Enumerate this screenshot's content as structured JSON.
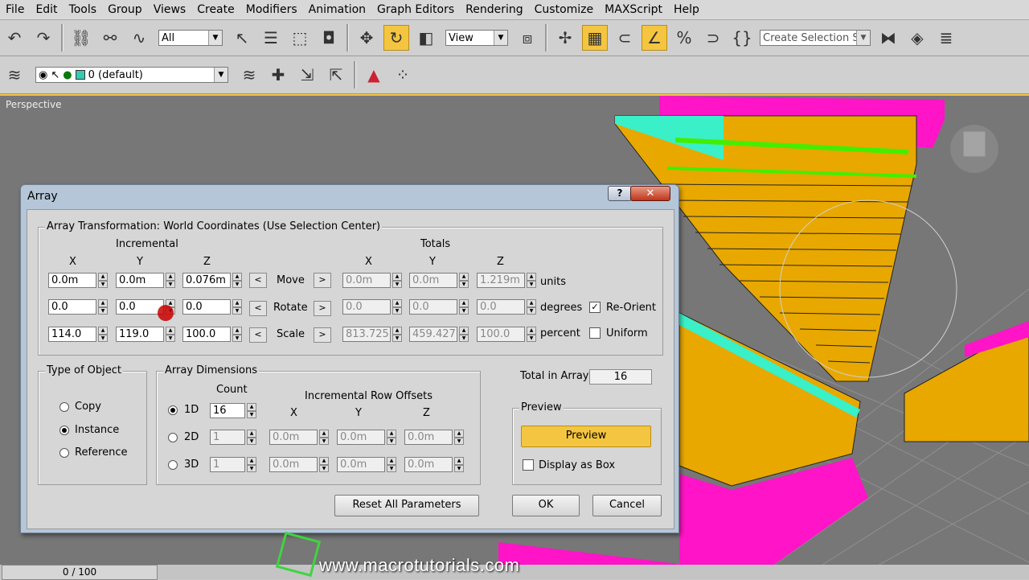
{
  "menu": [
    "File",
    "Edit",
    "Tools",
    "Group",
    "Views",
    "Create",
    "Modifiers",
    "Animation",
    "Graph Editors",
    "Rendering",
    "Customize",
    "MAXScript",
    "Help"
  ],
  "toolbar": {
    "selection_filter": "All",
    "ref_coord": "View",
    "selection_set_placeholder": "Create Selection Set"
  },
  "layer_toolbar": {
    "layer_name": "0 (default)"
  },
  "viewport": {
    "label": "Perspective"
  },
  "timeslider": {
    "value": "0 / 100"
  },
  "watermark": "www.macrotutorials.com",
  "dialog": {
    "title": "Array",
    "help_label": "?",
    "close_label": "✕",
    "transform_group_title": "Array Transformation: World Coordinates (Use Selection Center)",
    "incremental_label": "Incremental",
    "totals_label": "Totals",
    "axis_labels": [
      "X",
      "Y",
      "Z"
    ],
    "rows": [
      {
        "name": "Move",
        "inc": [
          "0.0m",
          "0.0m",
          "0.076m"
        ],
        "tot": [
          "0.0m",
          "0.0m",
          "1.219m"
        ],
        "unit": "units"
      },
      {
        "name": "Rotate",
        "inc": [
          "0.0",
          "0.0",
          "0.0"
        ],
        "tot": [
          "0.0",
          "0.0",
          "0.0"
        ],
        "unit": "degrees"
      },
      {
        "name": "Scale",
        "inc": [
          "114.0",
          "119.0",
          "100.0"
        ],
        "tot": [
          "813.725",
          "459.427",
          "100.0"
        ],
        "unit": "percent"
      }
    ],
    "arrow_left": "<",
    "arrow_right": ">",
    "reorient_label": "Re-Orient",
    "reorient_checked": true,
    "uniform_label": "Uniform",
    "uniform_checked": false,
    "type_group_title": "Type of Object",
    "type_options": [
      "Copy",
      "Instance",
      "Reference"
    ],
    "type_selected": "Instance",
    "dims_group_title": "Array Dimensions",
    "count_label": "Count",
    "row_offsets_label": "Incremental Row Offsets",
    "dims": [
      {
        "label": "1D",
        "count": "16",
        "offsets": []
      },
      {
        "label": "2D",
        "count": "1",
        "offsets": [
          "0.0m",
          "0.0m",
          "0.0m"
        ]
      },
      {
        "label": "3D",
        "count": "1",
        "offsets": [
          "0.0m",
          "0.0m",
          "0.0m"
        ]
      }
    ],
    "dims_selected": "1D",
    "total_label": "Total in Array:",
    "total_value": "16",
    "preview_group_title": "Preview",
    "preview_button": "Preview",
    "display_box_label": "Display as Box",
    "display_box_checked": false,
    "reset_button": "Reset All Parameters",
    "ok_button": "OK",
    "cancel_button": "Cancel"
  },
  "colors": {
    "accent": "#f4c540",
    "viewport_bg": "#777777",
    "geometry_orange": "#e8a800",
    "geometry_magenta": "#ff14c8",
    "geometry_cyan": "#39f0c8",
    "geometry_green": "#44ee00"
  }
}
